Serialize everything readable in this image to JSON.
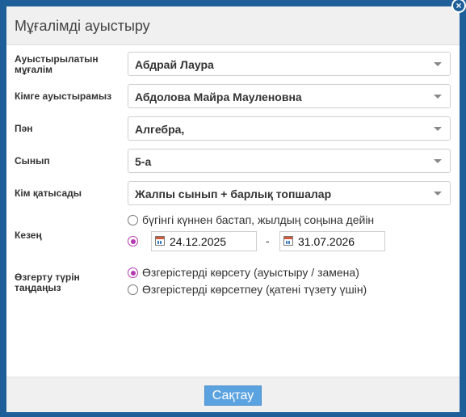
{
  "dialog": {
    "title": "Мұғалімді ауыстыру",
    "close_label": "×"
  },
  "fields": {
    "teacher": {
      "label": "Ауыстырылатын мұғалім",
      "value": "Абдрай Лаура"
    },
    "replacement": {
      "label": "Кімге ауыстырамыз",
      "value": "Абдолова Майра Мауленовна"
    },
    "subject": {
      "label": "Пән",
      "value": "Алгебра,"
    },
    "class": {
      "label": "Сынып",
      "value": "5-а"
    },
    "participants": {
      "label": "Кім қатысады",
      "value": "Жалпы сынып + барлық топшалар"
    }
  },
  "period": {
    "label": "Кезең",
    "option_until_year_end": {
      "label": "бүгінгі күннен бастап, жылдың соңына дейін",
      "selected": false
    },
    "option_range": {
      "selected": true
    },
    "date_from": "24.12.2025",
    "separator": "-",
    "date_to": "31.07.2026"
  },
  "change_type": {
    "label": "Өзгерту түрін таңдаңыз",
    "option_show": {
      "label": "Өзгерістерді көрсету (ауыстыру / замена)",
      "selected": true
    },
    "option_hide": {
      "label": "Өзгерістерді көрсетпеу (қатені түзету үшін)",
      "selected": false
    }
  },
  "footer": {
    "save_label": "Сақтау"
  },
  "colors": {
    "frame": "#1e5f9a",
    "accent_radio": "#b339b0",
    "save_button": "#5ba3e0"
  }
}
